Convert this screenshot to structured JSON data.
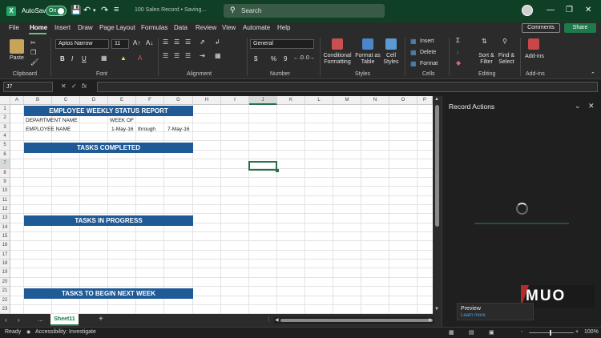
{
  "titlebar": {
    "autosave_label": "AutoSave",
    "toggle_label": "On",
    "doc_title": "100 Sales Record • Saving...",
    "search_placeholder": "Search"
  },
  "menu": [
    "File",
    "Home",
    "Insert",
    "Draw",
    "Page Layout",
    "Formulas",
    "Data",
    "Review",
    "View",
    "Automate",
    "Help"
  ],
  "menu_actions": {
    "comments": "Comments",
    "share": "Share"
  },
  "ribbon": {
    "clipboard": {
      "paste": "Paste",
      "label": "Clipboard"
    },
    "font": {
      "name": "Aptos Narrow",
      "size": "11",
      "bold": "B",
      "italic": "I",
      "underline": "U",
      "label": "Font"
    },
    "alignment": {
      "label": "Alignment"
    },
    "number": {
      "format": "General",
      "currency": "$",
      "percent": "%",
      "comma": "9",
      "label": "Number"
    },
    "styles": {
      "conditional": "Conditional Formatting",
      "format_as_table": "Format as Table",
      "cell_styles": "Cell Styles",
      "label": "Styles"
    },
    "cells": {
      "insert": "Insert",
      "delete": "Delete",
      "format": "Format",
      "label": "Cells"
    },
    "editing": {
      "sort_filter": "Sort & Filter",
      "find_select": "Find & Select",
      "label": "Editing"
    },
    "addins": {
      "addins": "Add-ins",
      "label": "Add-ins"
    }
  },
  "formula_bar": {
    "name_box": "J7",
    "fx": "fx",
    "value": ""
  },
  "grid": {
    "columns": [
      "A",
      "B",
      "C",
      "D",
      "E",
      "F",
      "G",
      "H",
      "I",
      "J",
      "K",
      "L",
      "M",
      "N",
      "O",
      "P"
    ],
    "rows": [
      "1",
      "2",
      "3",
      "4",
      "5",
      "6",
      "7",
      "8",
      "9",
      "10",
      "11",
      "12",
      "13",
      "14",
      "15",
      "16",
      "17",
      "18",
      "19",
      "20",
      "21",
      "22",
      "23"
    ],
    "title": "EMPLOYEE WEEKLY STATUS REPORT",
    "dept_label": "DEPARTMENT NAME",
    "week_of": "WEEK OF",
    "employee_label": "EMPLOYEE NAME",
    "date_from": "1-May-16",
    "through": "through",
    "date_to": "7-May-16",
    "section_completed": "TASKS COMPLETED",
    "section_in_progress": "TASKS IN PROGRESS",
    "section_next_week": "TASKS TO BEGIN NEXT WEEK",
    "header_bg": "#1f5a96"
  },
  "sheets": {
    "active": "Sheet11",
    "add_label": "+",
    "more_label": "..."
  },
  "status": {
    "ready": "Ready",
    "accessibility": "Accessibility: Investigate",
    "zoom": "100%",
    "zoom_minus": "-",
    "zoom_plus": "+"
  },
  "pane": {
    "title": "Record Actions",
    "preview_label": "Preview",
    "learn_more": "Learn more",
    "watermark": "MUO"
  },
  "colors": {
    "accent": "#217346",
    "title_bar": "#0f3f24"
  }
}
